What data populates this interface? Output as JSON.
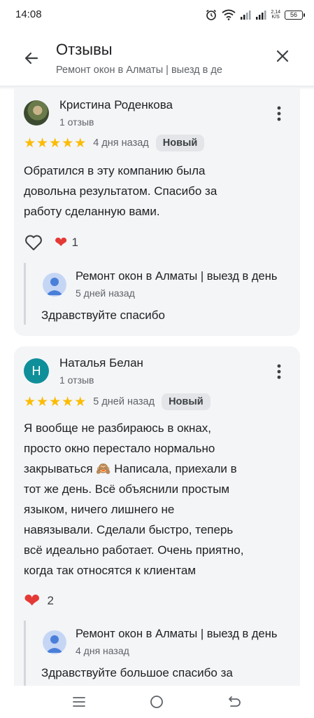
{
  "status_bar": {
    "time": "14:08",
    "icons": [
      "alarm-icon",
      "wifi-icon",
      "signal-icon",
      "signal-icon",
      "network-speed-icon",
      "battery-icon"
    ],
    "net_speed_value": "2,14",
    "net_speed_unit": "K/S",
    "battery_level": "56"
  },
  "header": {
    "title": "Отзывы",
    "subtitle": "Ремонт окон в Алматы | выезд в де",
    "back_icon": "arrow-left-icon",
    "close_icon": "close-icon"
  },
  "reviews": [
    {
      "name": "Кристина Роденкова",
      "review_count": "1 отзыв",
      "rating": 5,
      "date": "4 дня назад",
      "badge": "Новый",
      "text_lines": [
        "Обратился в эту компанию была",
        "довольна результатом. Спасибо за",
        "работу сделанную вами."
      ],
      "like_count": "1",
      "reply": {
        "name": "Ремонт окон в Алматы | выезд в день",
        "date": "5 дней назад",
        "text": "Здравствуйте спасибо"
      }
    },
    {
      "avatar_letter": "Н",
      "name": "Наталья Белан",
      "review_count": "1 отзыв",
      "rating": 5,
      "date": "5 дней назад",
      "badge": "Новый",
      "text_lines": [
        "Я вообще не разбираюсь в окнах,",
        "просто окно перестало нормально",
        "закрываться 🙈 Написала, приехали в",
        "тот же день. Всё объяснили простым",
        "языком, ничего лишнего не",
        "навязывали. Сделали быстро, теперь",
        "всё идеально работает. Очень приятно,",
        "когда так относятся к клиентам"
      ],
      "like_count": "2",
      "reply": {
        "name": "Ремонт окон в Алматы | выезд в день",
        "date": "4 дня назад",
        "text": "Здравствуйте большое спасибо за"
      }
    }
  ],
  "colors": {
    "star": "#fbbc04",
    "heart": "#e53935",
    "card_bg": "#f4f5f7",
    "avatar_teal": "#0f8f99"
  },
  "nav_bar": [
    "menu-icon",
    "home-icon",
    "back-icon"
  ]
}
